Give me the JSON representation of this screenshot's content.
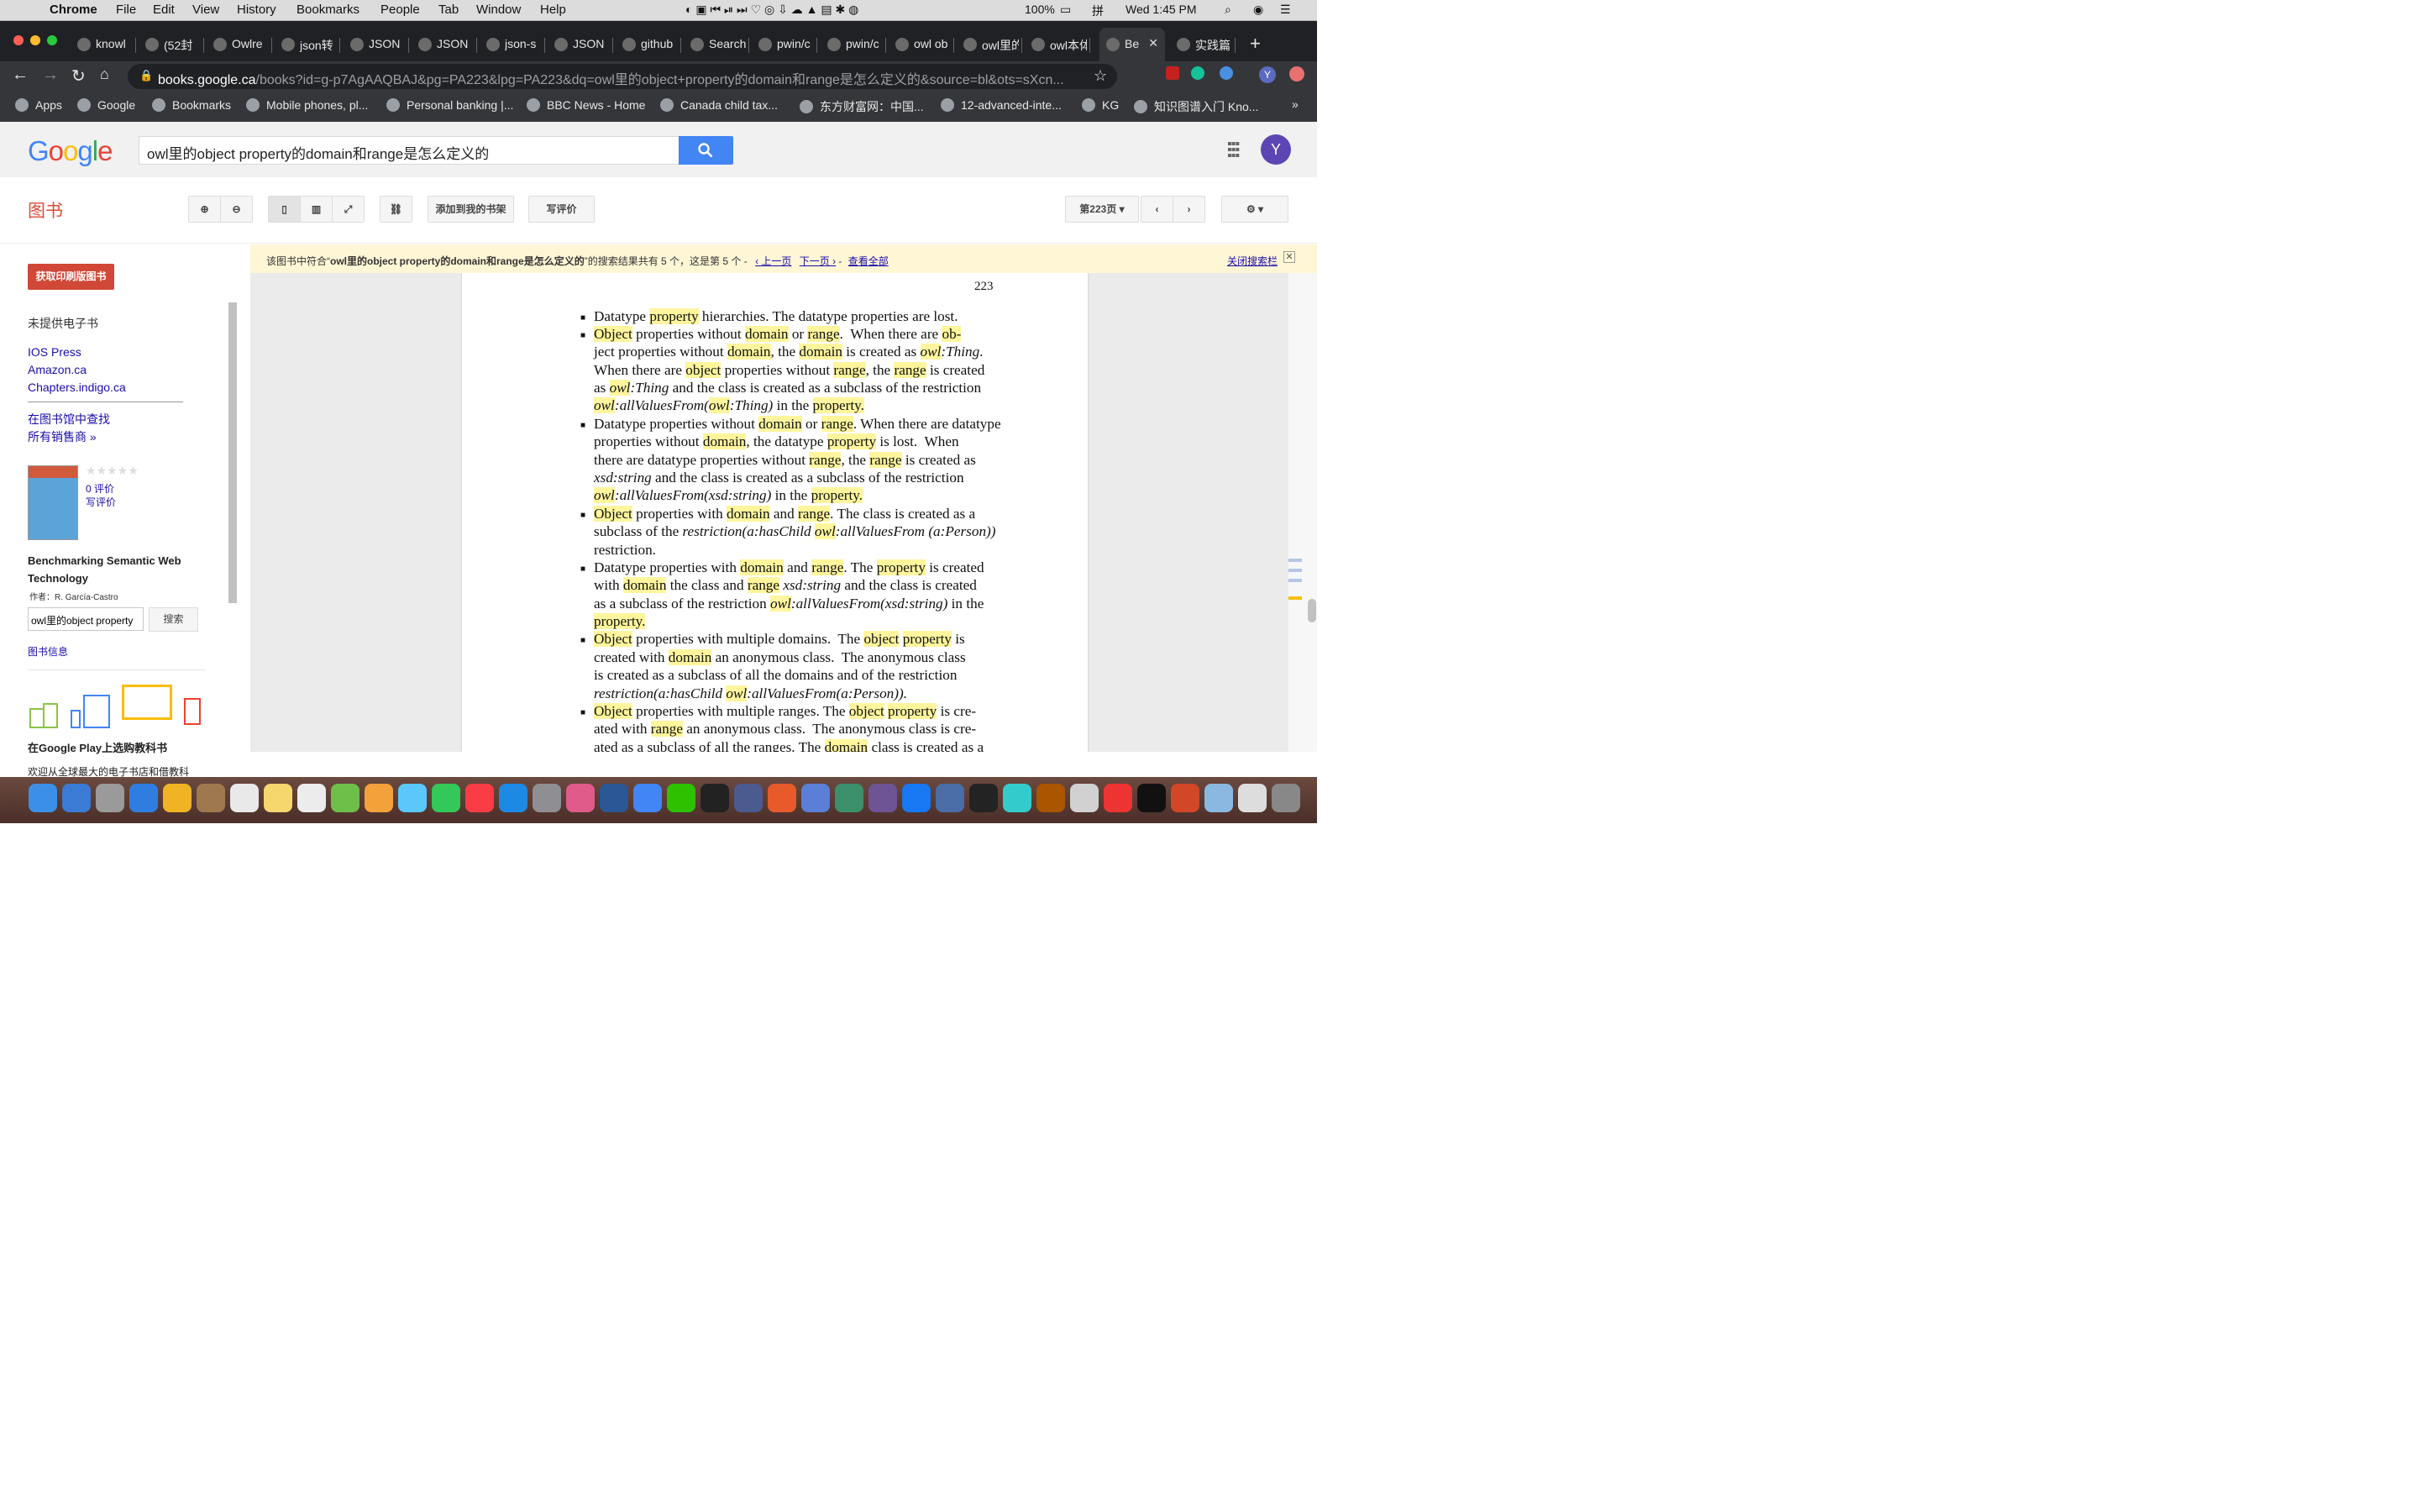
{
  "menubar": {
    "app": "Chrome",
    "menus": [
      "File",
      "Edit",
      "View",
      "History",
      "Bookmarks",
      "People",
      "Tab",
      "Window",
      "Help"
    ],
    "battery": "100%",
    "clock": "Wed 1:45 PM"
  },
  "tabs": [
    {
      "title": "knowl"
    },
    {
      "title": "(52封"
    },
    {
      "title": "Owlre"
    },
    {
      "title": "json转"
    },
    {
      "title": "JSON"
    },
    {
      "title": "JSON"
    },
    {
      "title": "json-s"
    },
    {
      "title": "JSON"
    },
    {
      "title": "github"
    },
    {
      "title": "Search"
    },
    {
      "title": "pwin/c"
    },
    {
      "title": "pwin/c"
    },
    {
      "title": "owl ob"
    },
    {
      "title": "owl里的"
    },
    {
      "title": "owl本体"
    },
    {
      "title": "Be",
      "active": true
    },
    {
      "title": "实践篇"
    }
  ],
  "address": {
    "host": "books.google.ca",
    "path": "/books?id=g-p7AgAAQBAJ&pg=PA223&lpg=PA223&dq=owl里的object+property的domain和range是怎么定义的&source=bl&ots=sXcn..."
  },
  "bookmarks": [
    {
      "label": "Apps"
    },
    {
      "label": "Google"
    },
    {
      "label": "Bookmarks"
    },
    {
      "label": "Mobile phones, pl..."
    },
    {
      "label": "Personal banking |..."
    },
    {
      "label": "BBC News - Home"
    },
    {
      "label": "Canada child tax..."
    },
    {
      "label": "东方财富网：中国..."
    },
    {
      "label": "12-advanced-inte..."
    },
    {
      "label": "KG"
    },
    {
      "label": "知识图谱入门 Kno..."
    }
  ],
  "google": {
    "logo_letters": [
      "G",
      "o",
      "o",
      "g",
      "l",
      "e"
    ],
    "logo_colors": [
      "#4285f4",
      "#ea4335",
      "#fbbc05",
      "#4285f4",
      "#34a853",
      "#ea4335"
    ],
    "query": "owl里的object property的domain和range是怎么定义的",
    "avatar_letter": "Y"
  },
  "books_toolbar": {
    "section_title": "图书",
    "add_to_shelf": "添加到我的书架",
    "write_review": "写评价",
    "page_select": "第223页"
  },
  "notice": {
    "prefix": "该图书中符合“",
    "query": "owl里的object property的domain和range是怎么定义的",
    "suffix": "”的搜索结果共有 5 个，这是第 5 个 -",
    "prev": "‹ 上一页",
    "next": "下一页 ›",
    "all": "查看全部",
    "close": "关闭搜索栏"
  },
  "sidebar": {
    "buy_button": "获取印刷版图书",
    "no_ebook": "未提供电子书",
    "stores": [
      "IOS Press",
      "Amazon.ca",
      "Chapters.indigo.ca"
    ],
    "library": "在图书馆中查找",
    "all_sellers": "所有销售商 »",
    "stars": "★★★★★",
    "reviews_count": "0 评价",
    "write_review": "写评价",
    "book_title": "Benchmarking Semantic Web Technology",
    "author": "作者：R. García-Castro",
    "search_value": "owl里的object property",
    "search_button": "搜索",
    "book_info": "图书信息",
    "play_promo": "在Google Play上选购教科书",
    "play_sub": "欢迎从全球最大的电子书店和借教科"
  },
  "book_page": {
    "page_number": "223"
  }
}
